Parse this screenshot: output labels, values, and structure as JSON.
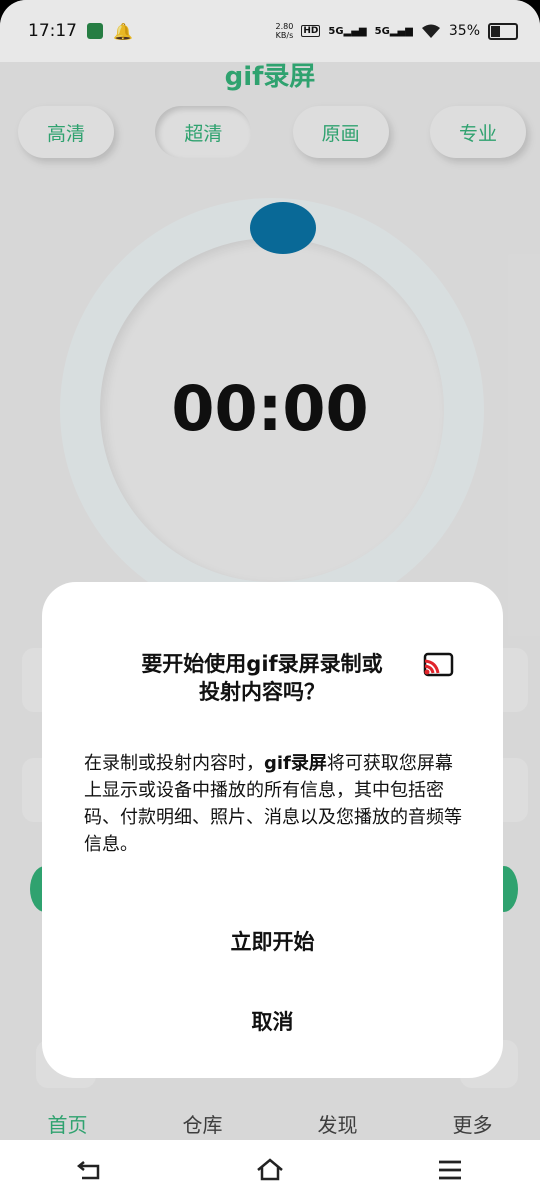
{
  "status_bar": {
    "time": "17:17",
    "net_speed_value": "2.80",
    "net_speed_unit": "KB/s",
    "hd_label": "HD",
    "sim1_label": "5G",
    "sim2_label": "5G",
    "battery_percent": "35%",
    "battery_level": 0.35
  },
  "app": {
    "title": "gif录屏",
    "quality_options": [
      "高清",
      "超清",
      "原画",
      "专业"
    ],
    "active_quality": "超清",
    "timer": "00:00"
  },
  "tabs": [
    "首页",
    "仓库",
    "发现",
    "更多"
  ],
  "active_tab": "首页",
  "dialog": {
    "title_line1": "要开始使用gif录屏录制或",
    "title_line2": "投射内容吗？",
    "body_prefix": "在录制或投射内容时，",
    "body_app": "gif录屏",
    "body_rest": "将可获取您屏幕上显示或设备中播放的所有信息，其中包括密码、付款明细、照片、消息以及您播放的音频等信息。",
    "start_button": "立即开始",
    "cancel_button": "取消"
  },
  "colors": {
    "accent_green": "#34b27a",
    "knob_blue": "#0a74a6",
    "cast_red": "#e0242b"
  }
}
